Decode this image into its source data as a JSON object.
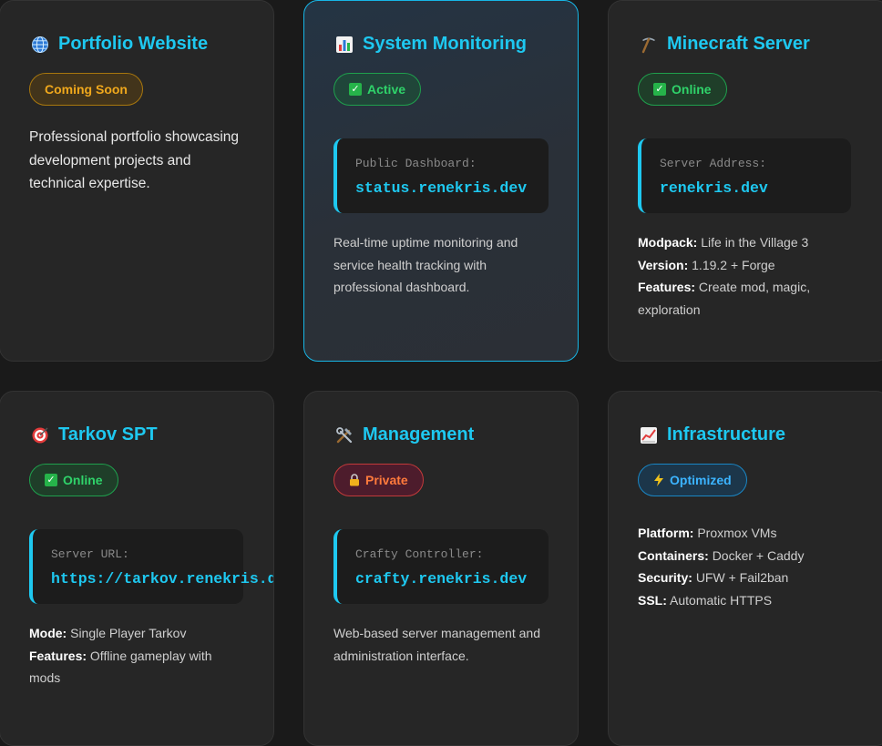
{
  "cards": [
    {
      "title": "Portfolio Website",
      "icon": "globe-icon",
      "badge": "Coming Soon",
      "description": "Professional portfolio showcasing development projects and technical expertise."
    },
    {
      "title": "System Monitoring",
      "icon": "bar-chart-icon",
      "badge": "Active",
      "code_label": "Public Dashboard:",
      "code_value": "status.renekris.dev",
      "description": "Real-time uptime monitoring and service health tracking with professional dashboard."
    },
    {
      "title": "Minecraft Server",
      "icon": "pickaxe-icon",
      "badge": "Online",
      "code_label": "Server Address:",
      "code_value": "renekris.dev",
      "details": [
        {
          "key": "Modpack:",
          "value": "Life in the Village 3"
        },
        {
          "key": "Version:",
          "value": "1.19.2 + Forge"
        },
        {
          "key": "Features:",
          "value": "Create mod, magic, exploration"
        }
      ]
    },
    {
      "title": "Tarkov SPT",
      "icon": "target-icon",
      "badge": "Online",
      "code_label": "Server URL:",
      "code_value": "https://tarkov.renekris.dev",
      "details": [
        {
          "key": "Mode:",
          "value": "Single Player Tarkov"
        },
        {
          "key": "Features:",
          "value": "Offline gameplay with mods"
        }
      ]
    },
    {
      "title": "Management",
      "icon": "tools-icon",
      "badge": "Private",
      "code_label": "Crafty Controller:",
      "code_value": "crafty.renekris.dev",
      "description": "Web-based server management and administration interface."
    },
    {
      "title": "Infrastructure",
      "icon": "trend-chart-icon",
      "badge": "Optimized",
      "details": [
        {
          "key": "Platform:",
          "value": "Proxmox VMs"
        },
        {
          "key": "Containers:",
          "value": "Docker + Caddy"
        },
        {
          "key": "Security:",
          "value": "UFW + Fail2ban"
        },
        {
          "key": "SSL:",
          "value": "Automatic HTTPS"
        }
      ]
    }
  ]
}
